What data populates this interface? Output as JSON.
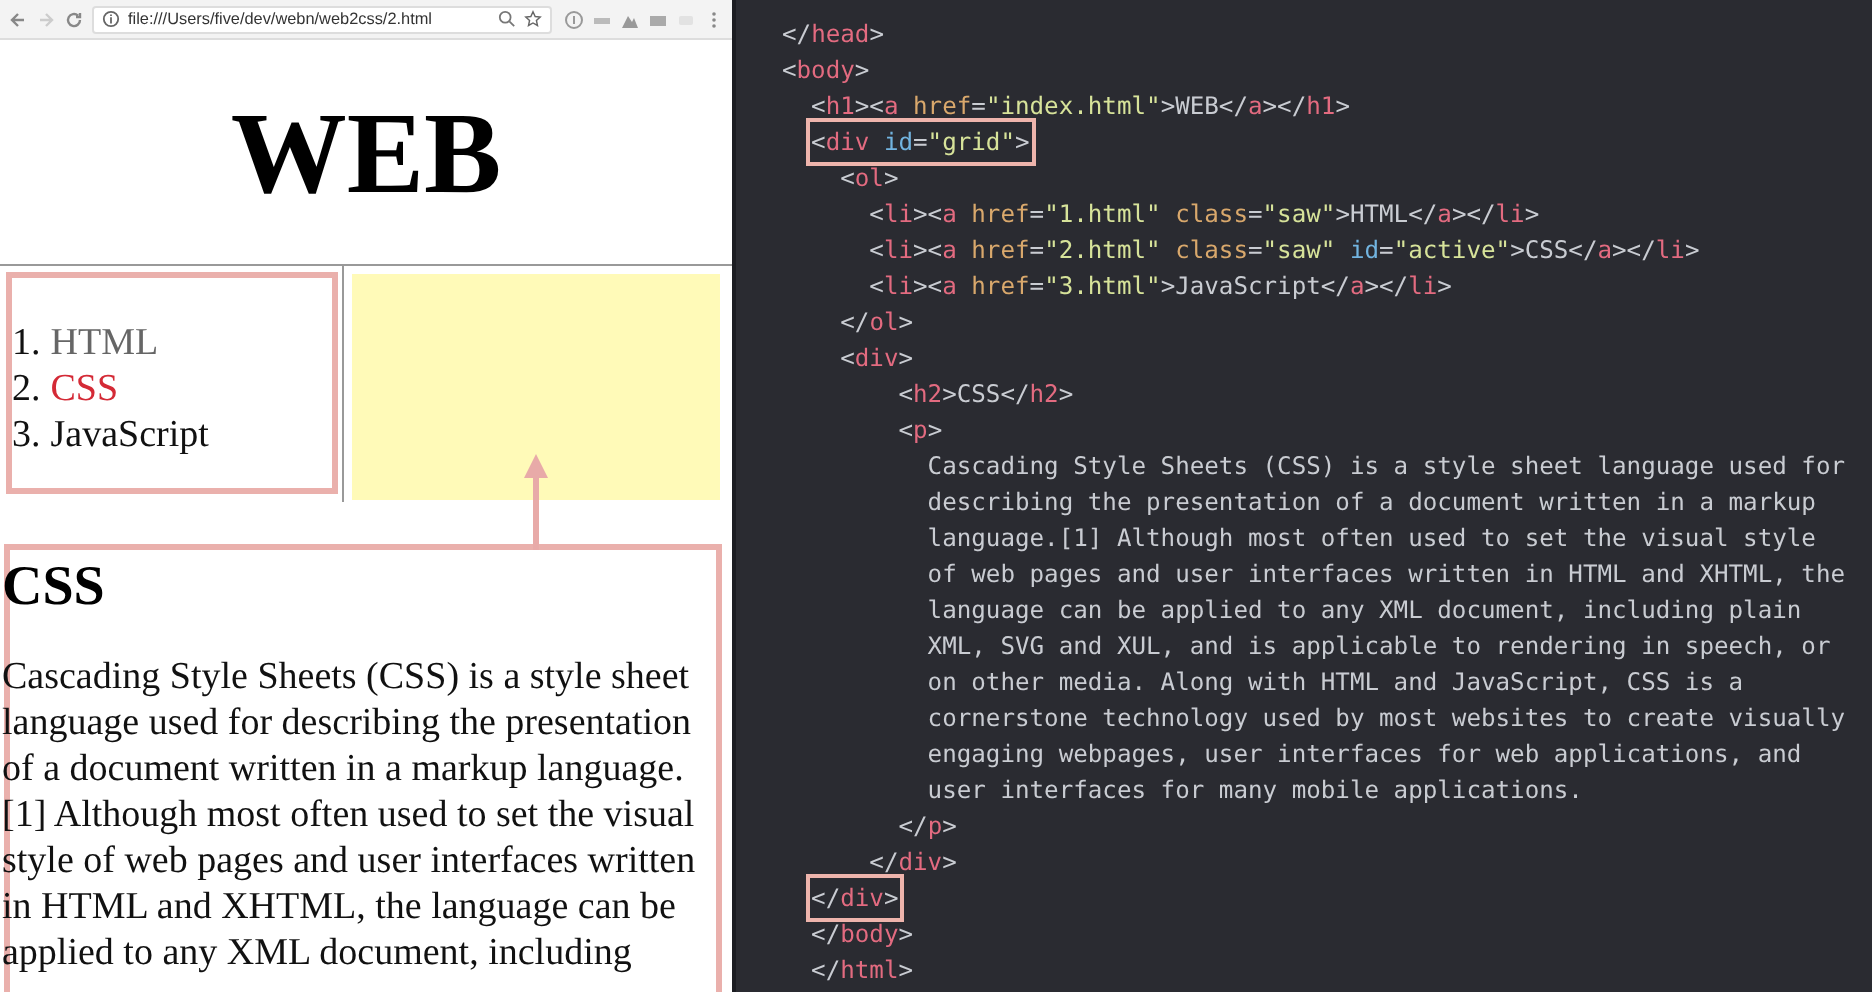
{
  "browser": {
    "url": "file:///Users/five/dev/webn/web2css/2.html"
  },
  "page": {
    "heading": "WEB",
    "nav": [
      {
        "number": "1.",
        "label": "HTML",
        "visited": true,
        "selected": false
      },
      {
        "number": "2.",
        "label": "CSS",
        "visited": false,
        "selected": true
      },
      {
        "number": "3.",
        "label": "JavaScript",
        "visited": false,
        "selected": false
      }
    ],
    "article": {
      "heading": "CSS",
      "paragraph": "Cascading Style Sheets (CSS) is a style sheet language used for describing the presentation of a document written in a markup language. [1] Although most often used to set the visual style of web pages and user interfaces written in HTML and XHTML, the language can be applied to any XML document, including"
    }
  },
  "editor": {
    "lines": [
      {
        "boxed": false,
        "tokens": [
          {
            "kind": "plain",
            "text": "</"
          },
          {
            "kind": "tag",
            "text": "head"
          },
          {
            "kind": "plain",
            "text": ">"
          }
        ]
      },
      {
        "boxed": false,
        "tokens": [
          {
            "kind": "plain",
            "text": "<"
          },
          {
            "kind": "tag",
            "text": "body"
          },
          {
            "kind": "plain",
            "text": ">"
          }
        ]
      },
      {
        "boxed": false,
        "tokens": [
          {
            "kind": "plain",
            "text": "  <"
          },
          {
            "kind": "tag",
            "text": "h1"
          },
          {
            "kind": "plain",
            "text": "><"
          },
          {
            "kind": "tag",
            "text": "a"
          },
          {
            "kind": "attr",
            "text": " href"
          },
          {
            "kind": "plain",
            "text": "="
          },
          {
            "kind": "string",
            "text": "\"index.html\""
          },
          {
            "kind": "plain",
            "text": ">WEB</"
          },
          {
            "kind": "tag",
            "text": "a"
          },
          {
            "kind": "plain",
            "text": "></"
          },
          {
            "kind": "tag",
            "text": "h1"
          },
          {
            "kind": "plain",
            "text": ">"
          }
        ]
      },
      {
        "boxed": true,
        "tokens": [
          {
            "kind": "plain",
            "text": "<"
          },
          {
            "kind": "tag",
            "text": "div"
          },
          {
            "kind": "id",
            "text": " id"
          },
          {
            "kind": "plain",
            "text": "="
          },
          {
            "kind": "string",
            "text": "\"grid\""
          },
          {
            "kind": "plain",
            "text": ">"
          }
        ]
      },
      {
        "boxed": false,
        "tokens": [
          {
            "kind": "plain",
            "text": "    <"
          },
          {
            "kind": "tag",
            "text": "ol"
          },
          {
            "kind": "plain",
            "text": ">"
          }
        ]
      },
      {
        "boxed": false,
        "tokens": [
          {
            "kind": "plain",
            "text": "      <"
          },
          {
            "kind": "tag",
            "text": "li"
          },
          {
            "kind": "plain",
            "text": "><"
          },
          {
            "kind": "tag",
            "text": "a"
          },
          {
            "kind": "attr",
            "text": " href"
          },
          {
            "kind": "plain",
            "text": "="
          },
          {
            "kind": "string",
            "text": "\"1.html\""
          },
          {
            "kind": "attr",
            "text": " class"
          },
          {
            "kind": "plain",
            "text": "="
          },
          {
            "kind": "string",
            "text": "\"saw\""
          },
          {
            "kind": "plain",
            "text": ">HTML</"
          },
          {
            "kind": "tag",
            "text": "a"
          },
          {
            "kind": "plain",
            "text": "></"
          },
          {
            "kind": "tag",
            "text": "li"
          },
          {
            "kind": "plain",
            "text": ">"
          }
        ]
      },
      {
        "boxed": false,
        "tokens": [
          {
            "kind": "plain",
            "text": "      <"
          },
          {
            "kind": "tag",
            "text": "li"
          },
          {
            "kind": "plain",
            "text": "><"
          },
          {
            "kind": "tag",
            "text": "a"
          },
          {
            "kind": "attr",
            "text": " href"
          },
          {
            "kind": "plain",
            "text": "="
          },
          {
            "kind": "string",
            "text": "\"2.html\""
          },
          {
            "kind": "attr",
            "text": " class"
          },
          {
            "kind": "plain",
            "text": "="
          },
          {
            "kind": "string",
            "text": "\"saw\""
          },
          {
            "kind": "id",
            "text": " id"
          },
          {
            "kind": "plain",
            "text": "="
          },
          {
            "kind": "string",
            "text": "\"active\""
          },
          {
            "kind": "plain",
            "text": ">CSS</"
          },
          {
            "kind": "tag",
            "text": "a"
          },
          {
            "kind": "plain",
            "text": "></"
          },
          {
            "kind": "tag",
            "text": "li"
          },
          {
            "kind": "plain",
            "text": ">"
          }
        ]
      },
      {
        "boxed": false,
        "tokens": [
          {
            "kind": "plain",
            "text": "      <"
          },
          {
            "kind": "tag",
            "text": "li"
          },
          {
            "kind": "plain",
            "text": "><"
          },
          {
            "kind": "tag",
            "text": "a"
          },
          {
            "kind": "attr",
            "text": " href"
          },
          {
            "kind": "plain",
            "text": "="
          },
          {
            "kind": "string",
            "text": "\"3.html\""
          },
          {
            "kind": "plain",
            "text": ">JavaScript</"
          },
          {
            "kind": "tag",
            "text": "a"
          },
          {
            "kind": "plain",
            "text": "></"
          },
          {
            "kind": "tag",
            "text": "li"
          },
          {
            "kind": "plain",
            "text": ">"
          }
        ]
      },
      {
        "boxed": false,
        "tokens": [
          {
            "kind": "plain",
            "text": "    </"
          },
          {
            "kind": "tag",
            "text": "ol"
          },
          {
            "kind": "plain",
            "text": ">"
          }
        ]
      },
      {
        "boxed": false,
        "tokens": [
          {
            "kind": "plain",
            "text": "    <"
          },
          {
            "kind": "tag",
            "text": "div"
          },
          {
            "kind": "plain",
            "text": ">"
          }
        ]
      },
      {
        "boxed": false,
        "tokens": [
          {
            "kind": "plain",
            "text": "        <"
          },
          {
            "kind": "tag",
            "text": "h2"
          },
          {
            "kind": "plain",
            "text": ">CSS</"
          },
          {
            "kind": "tag",
            "text": "h2"
          },
          {
            "kind": "plain",
            "text": ">"
          }
        ]
      },
      {
        "boxed": false,
        "tokens": [
          {
            "kind": "plain",
            "text": "        <"
          },
          {
            "kind": "tag",
            "text": "p"
          },
          {
            "kind": "plain",
            "text": ">"
          }
        ]
      },
      {
        "boxed": false,
        "tokens": [
          {
            "kind": "plain",
            "text": "          Cascading Style Sheets (CSS) is a style sheet language used for"
          }
        ]
      },
      {
        "boxed": false,
        "tokens": [
          {
            "kind": "plain",
            "text": "          describing the presentation of a document written in a markup"
          }
        ]
      },
      {
        "boxed": false,
        "tokens": [
          {
            "kind": "plain",
            "text": "          language.[1] Although most often used to set the visual style"
          }
        ]
      },
      {
        "boxed": false,
        "tokens": [
          {
            "kind": "plain",
            "text": "          of web pages and user interfaces written in HTML and XHTML, the"
          }
        ]
      },
      {
        "boxed": false,
        "tokens": [
          {
            "kind": "plain",
            "text": "          language can be applied to any XML document, including plain"
          }
        ]
      },
      {
        "boxed": false,
        "tokens": [
          {
            "kind": "plain",
            "text": "          XML, SVG and XUL, and is applicable to rendering in speech, or"
          }
        ]
      },
      {
        "boxed": false,
        "tokens": [
          {
            "kind": "plain",
            "text": "          on other media. Along with HTML and JavaScript, CSS is a"
          }
        ]
      },
      {
        "boxed": false,
        "tokens": [
          {
            "kind": "plain",
            "text": "          cornerstone technology used by most websites to create visually"
          }
        ]
      },
      {
        "boxed": false,
        "tokens": [
          {
            "kind": "plain",
            "text": "          engaging webpages, user interfaces for web applications, and"
          }
        ]
      },
      {
        "boxed": false,
        "tokens": [
          {
            "kind": "plain",
            "text": "          user interfaces for many mobile applications."
          }
        ]
      },
      {
        "boxed": false,
        "tokens": [
          {
            "kind": "plain",
            "text": "        </"
          },
          {
            "kind": "tag",
            "text": "p"
          },
          {
            "kind": "plain",
            "text": ">"
          }
        ]
      },
      {
        "boxed": false,
        "tokens": [
          {
            "kind": "plain",
            "text": "      </"
          },
          {
            "kind": "tag",
            "text": "div"
          },
          {
            "kind": "plain",
            "text": ">"
          }
        ]
      },
      {
        "boxed": true,
        "tokens": [
          {
            "kind": "plain",
            "text": "</"
          },
          {
            "kind": "tag",
            "text": "div"
          },
          {
            "kind": "plain",
            "text": ">"
          }
        ]
      },
      {
        "boxed": false,
        "tokens": [
          {
            "kind": "plain",
            "text": "  </"
          },
          {
            "kind": "tag",
            "text": "body"
          },
          {
            "kind": "plain",
            "text": ">"
          }
        ]
      },
      {
        "boxed": false,
        "tokens": [
          {
            "kind": "plain",
            "text": "  </"
          },
          {
            "kind": "tag",
            "text": "html"
          },
          {
            "kind": "plain",
            "text": ">"
          }
        ]
      }
    ]
  }
}
